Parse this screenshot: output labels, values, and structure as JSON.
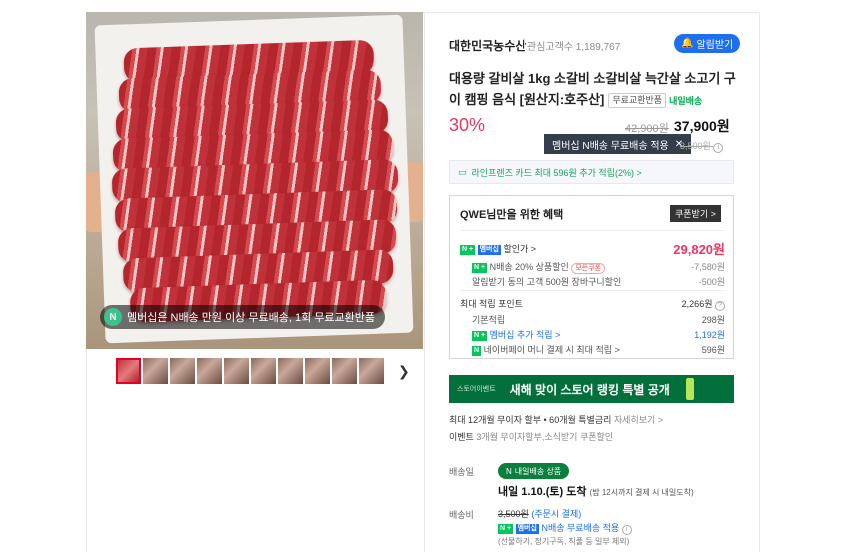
{
  "image_badge": "멤버십은 N배송 만원 이상 무료배송, 1회 무료교환반품",
  "thumbnail_count": 10,
  "seller": {
    "name": "대한민국농수산",
    "followers": "관심고객수 1,189,767",
    "alert_label": "알림받기"
  },
  "product": {
    "title": "대용량 갈비살 1kg 소갈비 소갈비살 늑간살 소고기 구이 캠핑 음식 [원산지:호주산]",
    "tag_free_exchange": "무료교환반품",
    "tag_delivery": "내일배송",
    "discount": "30%",
    "original_price": "42,900원",
    "sale_price": "37,900원",
    "tooltip": "멤버십 N배송 무료배송 적용",
    "ship_original": "3,500원"
  },
  "card_promo": "라인프렌즈 카드 최대 596원 추가 적립(2%) >",
  "benefit": {
    "title": "QWE님만을 위한 혜택",
    "coupon_btn": "쿠폰받기 >",
    "discount_label": "할인가 >",
    "discount_price": "29,820원",
    "n_discount_label": "N배송 20% 상품할인",
    "n_discount_tag": "모든쿠폰",
    "n_discount_value": "-7,580원",
    "alert_discount_label": "알림받기 동의 고객 500원 장바구니할인",
    "alert_discount_value": "-500원",
    "points_label": "최대 적립 포인트",
    "points_value": "2,266원",
    "basic_label": "기본적립",
    "basic_value": "298원",
    "member_label": "멤버십 추가 적립 >",
    "member_value": "1,192원",
    "npay_label": "네이버페이 머니 결제 시 최대 적립 >",
    "npay_value": "596원",
    "badge_n": "N +",
    "badge_member": "멤버십"
  },
  "banner": {
    "tag": "스토어이벤트",
    "text": "새해 맞이 스토어 랭킹 특별 공개"
  },
  "installment": {
    "text": "최대 12개월 무이자 할부 • 60개월 특별금리",
    "link": "자세히보기 >"
  },
  "event": {
    "label": "이벤트",
    "text": "3개월 무이자할부,소식받기 쿠폰할인"
  },
  "delivery": {
    "label": "배송일",
    "pill": "내일배송 상품",
    "date": "내일 1.10.(토) 도착",
    "note": "(밤 12시까지 결제 시 내일도착)",
    "fee_label": "배송비",
    "fee_original": "3,500원",
    "fee_method": "(주문시 결제)",
    "fee_free": "N배송 무료배송 적용",
    "fee_note": "(선물하기, 정기구독, 직풀 등 일부 제외)"
  },
  "colors": {
    "accent": "#f0355e",
    "naver_green": "#03c75a",
    "blue": "#1e6ff0",
    "banner": "#036f3b"
  }
}
